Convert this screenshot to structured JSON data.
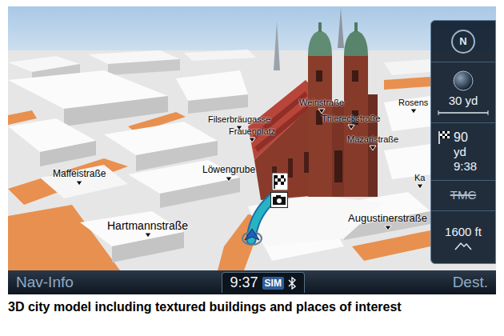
{
  "map": {
    "labels": [
      "Filserbräugasse",
      "Frauenplatz",
      "Weinstraße",
      "Thiereckstraße",
      "Mazaristraße",
      "Maffeistraße",
      "Löwengrube",
      "Hartmannstraße",
      "Augustinerstraße",
      "Rosens",
      "Ka"
    ]
  },
  "panel": {
    "compass": "N",
    "scale": "30 yd",
    "distance": "90",
    "distance_unit": "yd",
    "arrival": "9:38",
    "traffic": "TMC",
    "traffic_active": false,
    "altitude": "1600 ft"
  },
  "bottom_bar": {
    "left": "Nav-Info",
    "clock": "9:37",
    "sim": "SIM",
    "right": "Dest."
  },
  "caption": "3D city model including textured buildings and places of interest"
}
